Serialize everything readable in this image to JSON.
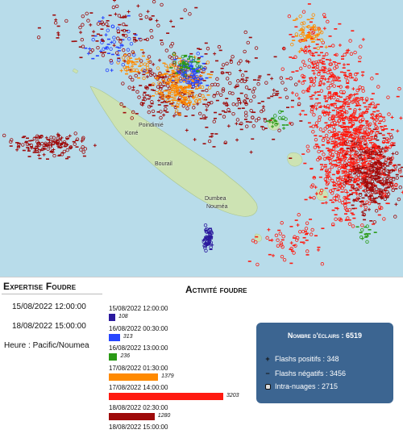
{
  "map": {
    "places": [
      {
        "name": "Koné"
      },
      {
        "name": "Poindimié"
      },
      {
        "name": "Bourail"
      },
      {
        "name": "Dumbea"
      },
      {
        "name": "Nouméa"
      }
    ],
    "colors": {
      "sea": "#b8dcea",
      "land": "#cde3b3",
      "period1": "#2b1a9e",
      "period2": "#2746ff",
      "period3": "#2a9a16",
      "period4": "#ff8a00",
      "period5": "#ff1a10",
      "period6": "#9e0b0b"
    }
  },
  "expertise": {
    "title": "Expertise Foudre",
    "start": "15/08/2022 12:00:00",
    "end": "18/08/2022 15:00:00",
    "timezone": "Heure : Pacific/Noumea"
  },
  "activity": {
    "title": "Activité foudre",
    "timestamps": [
      "15/08/2022 12:00:00",
      "16/08/2022 00:30:00",
      "16/08/2022 13:00:00",
      "17/08/2022 01:30:00",
      "17/08/2022 14:00:00",
      "18/08/2022 02:30:00",
      "18/08/2022 15:00:00"
    ],
    "bars": [
      {
        "value": "108",
        "count": 108,
        "color": "#2b1a9e"
      },
      {
        "value": "313",
        "count": 313,
        "color": "#2746ff"
      },
      {
        "value": "236",
        "count": 236,
        "color": "#2a9a16"
      },
      {
        "value": "1379",
        "count": 1379,
        "color": "#ff8a00"
      },
      {
        "value": "3203",
        "count": 3203,
        "color": "#ff1a10"
      },
      {
        "value": "1280",
        "count": 1280,
        "color": "#9e0b0b"
      }
    ]
  },
  "stats": {
    "title": "Nombre d'éclairs : 6519",
    "positive": "Flashs positifs : 348",
    "negative": "Flashs négatifs : 3456",
    "intra": "Intra-nuages : 2715"
  }
}
